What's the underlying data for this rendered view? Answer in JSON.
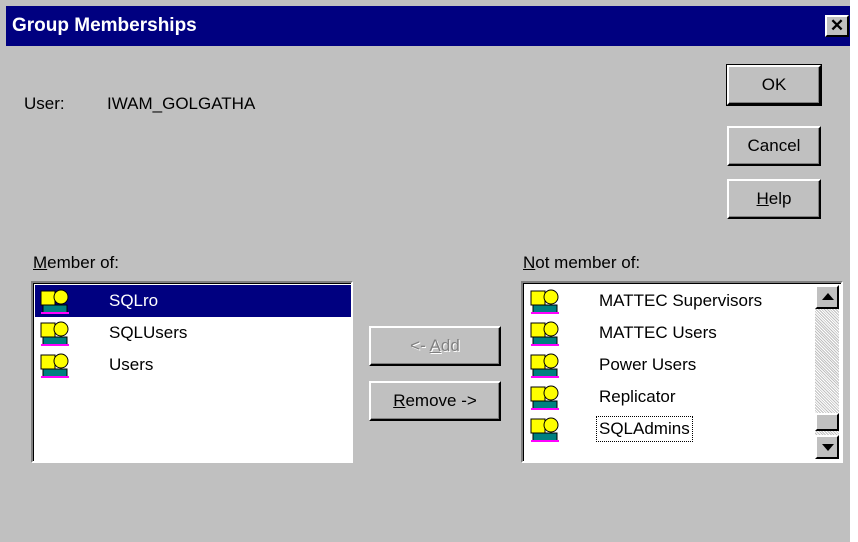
{
  "window": {
    "title": "Group Memberships",
    "close_glyph": "✕"
  },
  "user": {
    "label": "User:",
    "value": "IWAM_GOLGATHA"
  },
  "buttons": {
    "ok": "OK",
    "cancel": "Cancel",
    "help": {
      "mnemonic": "H",
      "rest": "elp"
    },
    "add": {
      "prefix": "<- ",
      "mnemonic": "A",
      "rest": "dd"
    },
    "remove": {
      "mnemonic": "R",
      "rest": "emove ->"
    }
  },
  "member_of": {
    "label": {
      "mnemonic": "M",
      "rest": "ember of:"
    },
    "items": [
      {
        "label": "SQLro",
        "icon": "group-icon",
        "selected": true
      },
      {
        "label": "SQLUsers",
        "icon": "group-icon"
      },
      {
        "label": "Users",
        "icon": "group-icon"
      }
    ]
  },
  "not_member_of": {
    "label": {
      "mnemonic": "N",
      "rest": "ot member of:"
    },
    "items": [
      {
        "label": "MATTEC Supervisors",
        "icon": "group-icon"
      },
      {
        "label": "MATTEC Users",
        "icon": "group-icon"
      },
      {
        "label": "Power Users",
        "icon": "group-icon"
      },
      {
        "label": "Replicator",
        "icon": "group-icon"
      },
      {
        "label": "SQLAdmins",
        "icon": "group-icon",
        "focused": true
      }
    ]
  },
  "colors": {
    "face": "#c0c0c0",
    "title_bar": "#000080",
    "selection": "#000080"
  }
}
